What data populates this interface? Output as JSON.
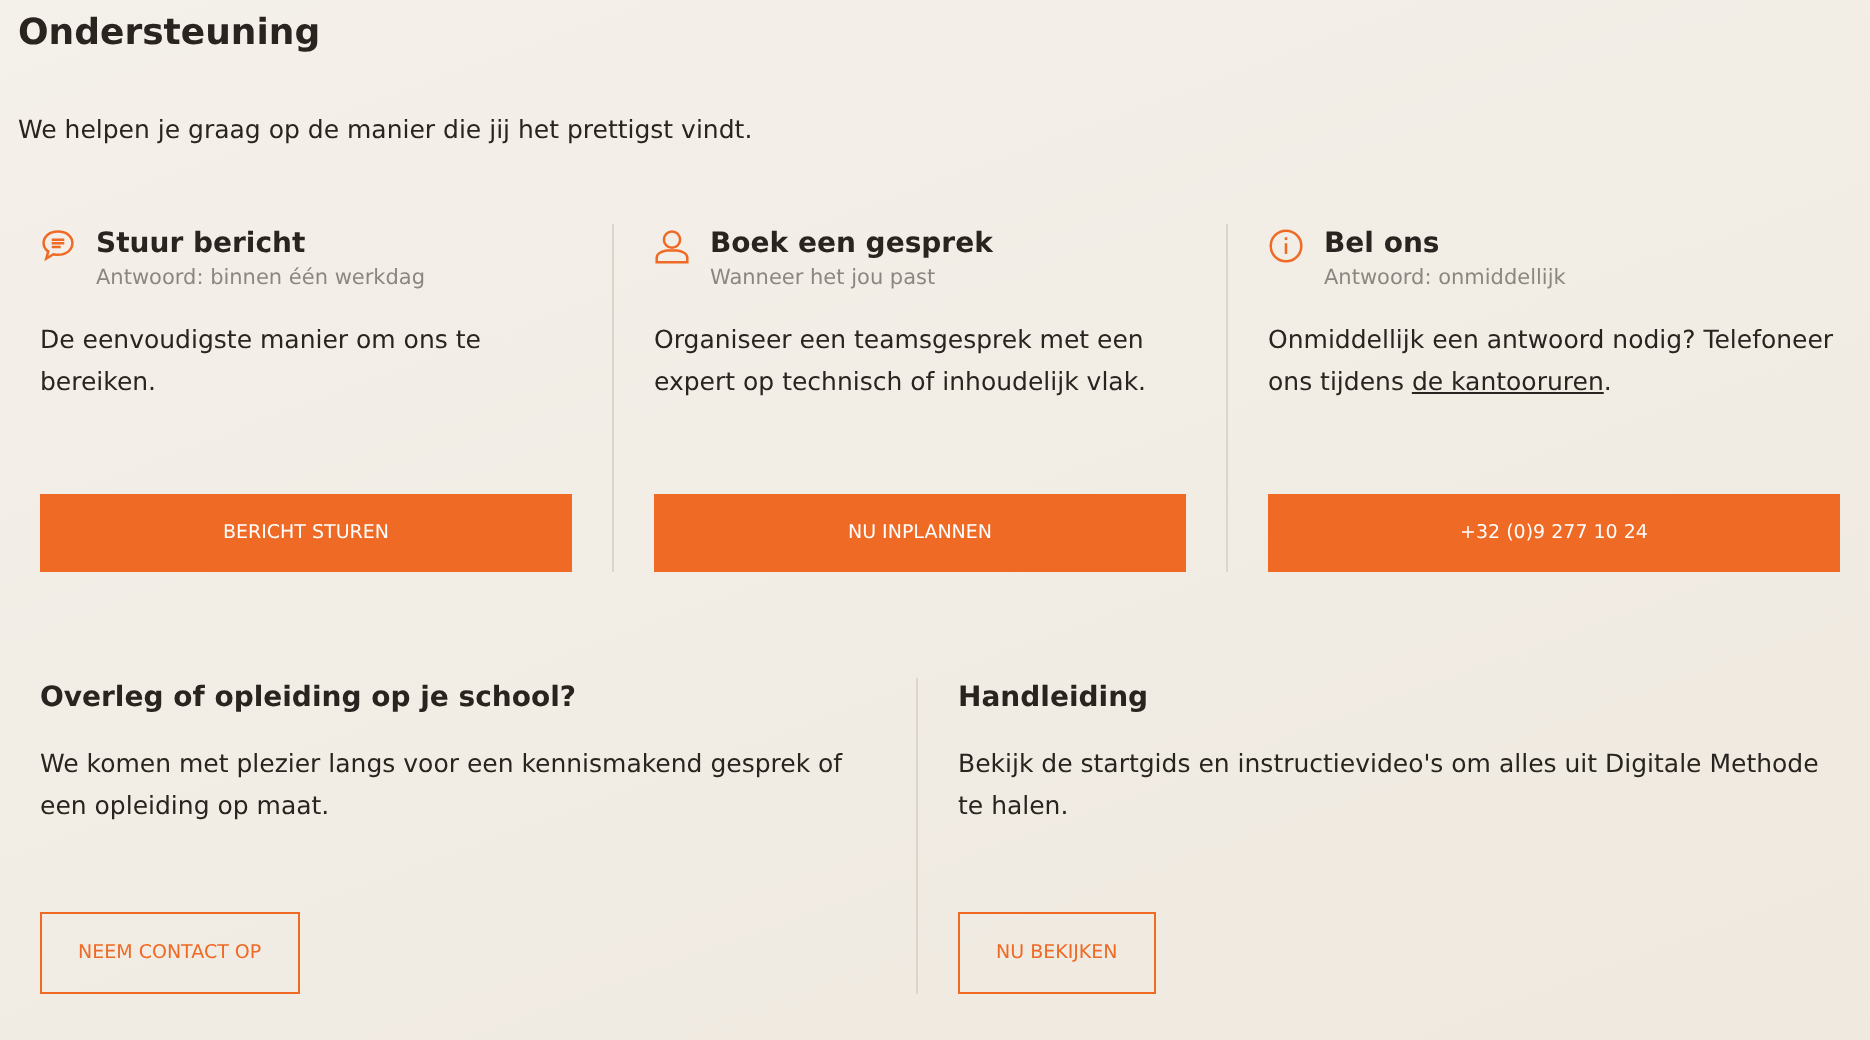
{
  "title": "Ondersteuning",
  "intro": "We helpen je graag op de manier die jij het prettigst vindt.",
  "contact_options": [
    {
      "kind": "chat",
      "title": "Stuur bericht",
      "subtitle": "Antwoord: binnen één werkdag",
      "body": "De eenvoudigste manier om ons te bereiken.",
      "button": "BERICHT STUREN"
    },
    {
      "kind": "person",
      "title": "Boek een gesprek",
      "subtitle": "Wanneer het jou past",
      "body": "Organiseer een teamsgesprek met een expert op technisch of inhoudelijk vlak.",
      "button": "NU INPLANNEN"
    },
    {
      "kind": "info",
      "title": "Bel ons",
      "subtitle": "Antwoord: onmiddellijk",
      "body": "Onmiddellijk een antwoord nodig? Telefoneer ons tijdens ",
      "link": "de kantooruren",
      "body_end": ".",
      "button": "+32 (0)9 277 10 24"
    }
  ],
  "sections": [
    {
      "title": "Overleg of opleiding op je school?",
      "body": "We komen met plezier langs voor een kennismakend gesprek of een opleiding op maat.",
      "button": "NEEM CONTACT OP"
    },
    {
      "title": "Handleiding",
      "body": "Bekijk de startgids en instructievideo's om alles uit Digitale Methode te halen.",
      "button": "NU BEKIJKEN"
    }
  ]
}
